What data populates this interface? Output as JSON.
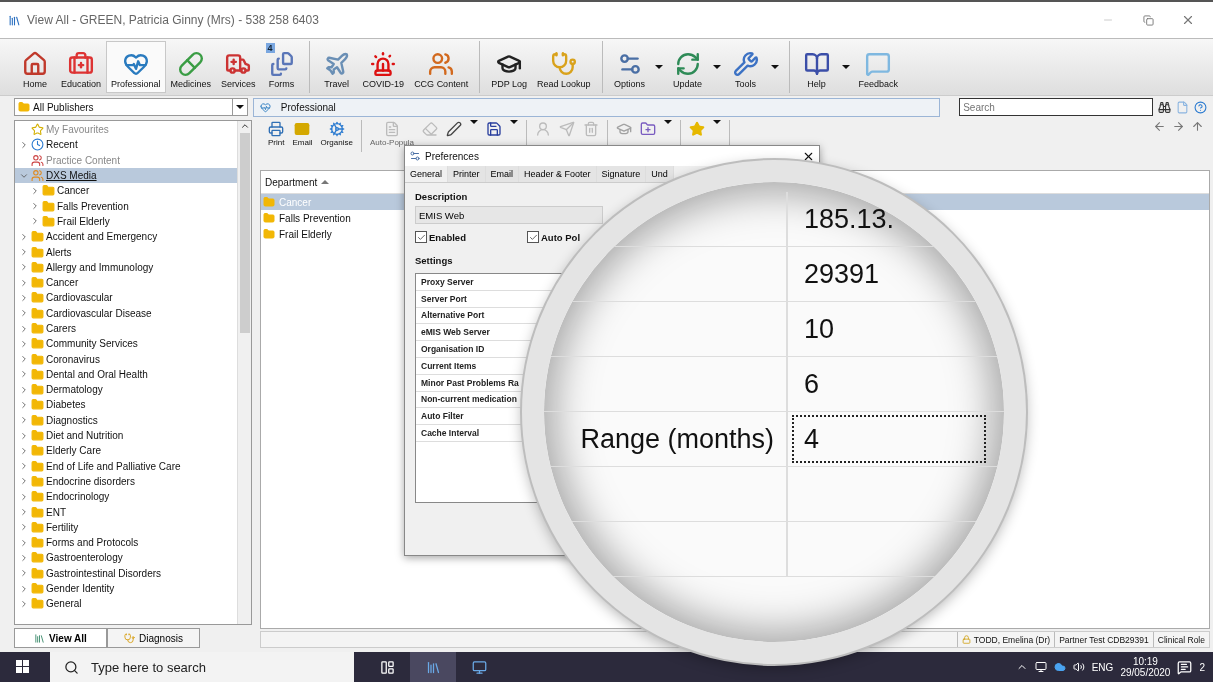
{
  "window": {
    "title": "View All  -  GREEN, Patricia Ginny (Mrs) - 538 258 6403"
  },
  "ribbon": [
    [
      {
        "label": "Home",
        "kind": "home",
        "selected": false
      },
      {
        "label": "Education",
        "kind": "education",
        "selected": false
      },
      {
        "label": "Professional",
        "kind": "professional",
        "selected": true
      },
      {
        "label": "Medicines",
        "kind": "medicines",
        "selected": false
      },
      {
        "label": "Services",
        "kind": "services",
        "selected": false
      },
      {
        "label": "Forms",
        "kind": "forms",
        "selected": false,
        "badge": "4"
      }
    ],
    [
      {
        "label": "Travel",
        "kind": "travel",
        "selected": false
      },
      {
        "label": "COVID-19",
        "kind": "covid",
        "selected": false
      },
      {
        "label": "CCG Content",
        "kind": "ccg",
        "selected": false
      }
    ],
    [
      {
        "label": "PDP Log",
        "kind": "pdp",
        "selected": false
      },
      {
        "label": "Read Lookup",
        "kind": "lookup",
        "selected": false
      }
    ],
    [
      {
        "label": "Options",
        "kind": "options",
        "selected": false,
        "dropdown": true
      },
      {
        "label": "Update",
        "kind": "update",
        "selected": false,
        "dropdown": true
      },
      {
        "label": "Tools",
        "kind": "tools",
        "selected": false,
        "dropdown": true
      }
    ],
    [
      {
        "label": "Help",
        "kind": "help",
        "selected": false,
        "dropdown": true
      },
      {
        "label": "Feedback",
        "kind": "feedback",
        "selected": false
      }
    ]
  ],
  "publisher_select": {
    "value": "All Publishers"
  },
  "breadcrumb": {
    "label": "Professional"
  },
  "search": {
    "placeholder": "Search"
  },
  "tree": [
    {
      "label": "My Favourites",
      "kind": "favourites",
      "expandable": false,
      "muted": true,
      "selected": false
    },
    {
      "label": "Recent",
      "kind": "recent",
      "expandable": true,
      "expanded": false,
      "muted": false,
      "selected": false
    },
    {
      "label": "Practice Content",
      "kind": "practice",
      "expandable": false,
      "muted": true,
      "selected": false
    },
    {
      "label": "DXS Media",
      "kind": "publisher",
      "expandable": true,
      "expanded": true,
      "muted": false,
      "selected": true,
      "children": [
        {
          "label": "Cancer",
          "kind": "folder",
          "expandable": true,
          "expanded": false,
          "muted": false,
          "selected": false
        },
        {
          "label": "Falls Prevention",
          "kind": "folder",
          "expandable": true,
          "expanded": false,
          "muted": false,
          "selected": false
        },
        {
          "label": "Frail Elderly",
          "kind": "folder",
          "expandable": true,
          "expanded": false,
          "muted": false,
          "selected": false
        }
      ]
    },
    {
      "label": "Accident and Emergency",
      "kind": "folder",
      "expandable": true,
      "expanded": false,
      "muted": false,
      "selected": false
    },
    {
      "label": "Alerts",
      "kind": "folder",
      "expandable": true,
      "expanded": false,
      "muted": false,
      "selected": false
    },
    {
      "label": "Allergy and Immunology",
      "kind": "folder",
      "expandable": true,
      "expanded": false,
      "muted": false,
      "selected": false
    },
    {
      "label": "Cancer",
      "kind": "folder",
      "expandable": true,
      "expanded": false,
      "muted": false,
      "selected": false
    },
    {
      "label": "Cardiovascular",
      "kind": "folder",
      "expandable": true,
      "expanded": false,
      "muted": false,
      "selected": false
    },
    {
      "label": "Cardiovascular Disease",
      "kind": "folder",
      "expandable": true,
      "expanded": false,
      "muted": false,
      "selected": false
    },
    {
      "label": "Carers",
      "kind": "folder",
      "expandable": true,
      "expanded": false,
      "muted": false,
      "selected": false
    },
    {
      "label": "Community Services",
      "kind": "folder",
      "expandable": true,
      "expanded": false,
      "muted": false,
      "selected": false
    },
    {
      "label": "Coronavirus",
      "kind": "folder",
      "expandable": true,
      "expanded": false,
      "muted": false,
      "selected": false
    },
    {
      "label": "Dental and Oral Health",
      "kind": "folder",
      "expandable": true,
      "expanded": false,
      "muted": false,
      "selected": false
    },
    {
      "label": "Dermatology",
      "kind": "folder",
      "expandable": true,
      "expanded": false,
      "muted": false,
      "selected": false
    },
    {
      "label": "Diabetes",
      "kind": "folder",
      "expandable": true,
      "expanded": false,
      "muted": false,
      "selected": false
    },
    {
      "label": "Diagnostics",
      "kind": "folder",
      "expandable": true,
      "expanded": false,
      "muted": false,
      "selected": false
    },
    {
      "label": "Diet and Nutrition",
      "kind": "folder",
      "expandable": true,
      "expanded": false,
      "muted": false,
      "selected": false
    },
    {
      "label": "Elderly Care",
      "kind": "folder",
      "expandable": true,
      "expanded": false,
      "muted": false,
      "selected": false
    },
    {
      "label": "End of Life and Palliative Care",
      "kind": "folder",
      "expandable": true,
      "expanded": false,
      "muted": false,
      "selected": false
    },
    {
      "label": "Endocrine disorders",
      "kind": "folder",
      "expandable": true,
      "expanded": false,
      "muted": false,
      "selected": false
    },
    {
      "label": "Endocrinology",
      "kind": "folder",
      "expandable": true,
      "expanded": false,
      "muted": false,
      "selected": false
    },
    {
      "label": "ENT",
      "kind": "folder",
      "expandable": true,
      "expanded": false,
      "muted": false,
      "selected": false
    },
    {
      "label": "Fertility",
      "kind": "folder",
      "expandable": true,
      "expanded": false,
      "muted": false,
      "selected": false
    },
    {
      "label": "Forms and Protocols",
      "kind": "folder",
      "expandable": true,
      "expanded": false,
      "muted": false,
      "selected": false
    },
    {
      "label": "Gastroenterology",
      "kind": "folder",
      "expandable": true,
      "expanded": false,
      "muted": false,
      "selected": false
    },
    {
      "label": "Gastrointestinal Disorders",
      "kind": "folder",
      "expandable": true,
      "expanded": false,
      "muted": false,
      "selected": false
    },
    {
      "label": "Gender Identity",
      "kind": "folder",
      "expandable": true,
      "expanded": false,
      "muted": false,
      "selected": false
    },
    {
      "label": "General",
      "kind": "folder",
      "expandable": true,
      "expanded": false,
      "muted": false,
      "selected": false
    }
  ],
  "bottom_tabs": [
    {
      "label": "View All",
      "kind": "all",
      "selected": true
    },
    {
      "label": "Diagnosis",
      "kind": "diagnosis",
      "selected": false
    }
  ],
  "toolbar": [
    [
      {
        "label": "Print",
        "kind": "print",
        "disabled": false
      },
      {
        "label": "Email",
        "kind": "email",
        "disabled": false
      },
      {
        "label": "Organise",
        "kind": "organise",
        "disabled": false
      }
    ],
    [
      {
        "label": "Auto-Popula",
        "kind": "populate",
        "disabled": true
      },
      {
        "kind": "clear",
        "disabled": true
      },
      {
        "kind": "sign",
        "disabled": false,
        "dropdown": true
      },
      {
        "kind": "save",
        "disabled": false,
        "dropdown": true
      }
    ],
    [
      {
        "kind": "assign",
        "disabled": true
      },
      {
        "kind": "submit",
        "disabled": true
      },
      {
        "kind": "discard",
        "disabled": true
      }
    ],
    [
      {
        "kind": "pdp",
        "disabled": true
      },
      {
        "kind": "content",
        "disabled": false,
        "dropdown": true
      }
    ],
    [
      {
        "kind": "favourites",
        "disabled": false,
        "dropdown": true
      }
    ]
  ],
  "list": {
    "column": "Department",
    "rows": [
      {
        "label": "Cancer",
        "selected": true
      },
      {
        "label": "Falls Prevention",
        "selected": false
      },
      {
        "label": "Frail Elderly",
        "selected": false
      }
    ]
  },
  "status_bar": [
    "TODD, Emelina (Dr)",
    "Partner Test CDB29391",
    "Clinical Role"
  ],
  "dialog": {
    "title": "Preferences",
    "tabs": [
      {
        "label": "General",
        "selected": true
      },
      {
        "label": "Printer",
        "selected": false
      },
      {
        "label": "Email",
        "selected": false
      },
      {
        "label": "Header & Footer",
        "selected": false
      },
      {
        "label": "Signature",
        "selected": false
      },
      {
        "label": "Und",
        "selected": false
      }
    ],
    "description_label": "Description",
    "description": "EMIS Web",
    "checkboxes": [
      {
        "label": "Enabled",
        "checked": true
      },
      {
        "label": "Auto Pol",
        "checked": true
      }
    ],
    "settings_label": "Settings",
    "settings": [
      "Proxy Server",
      "Server Port",
      "Alternative Port",
      "eMIS Web Server",
      "Organisation ID",
      "Current Items",
      "Minor Past Problems Ra",
      "Non-current medication",
      "Auto Filter",
      "Cache Interval"
    ]
  },
  "magnifier": {
    "rows": [
      {
        "value": "185.13.",
        "focused": false
      },
      {
        "value": "29391",
        "focused": false
      },
      {
        "value": "10",
        "focused": false
      },
      {
        "value": "6",
        "focused": false
      },
      {
        "label": "Range (months)",
        "value": "4",
        "focused": true
      }
    ]
  },
  "taskbar": {
    "search_placeholder": "Type here to search",
    "language": "ENG",
    "time": "10:19",
    "date": "29/05/2020",
    "notifications": "2"
  }
}
